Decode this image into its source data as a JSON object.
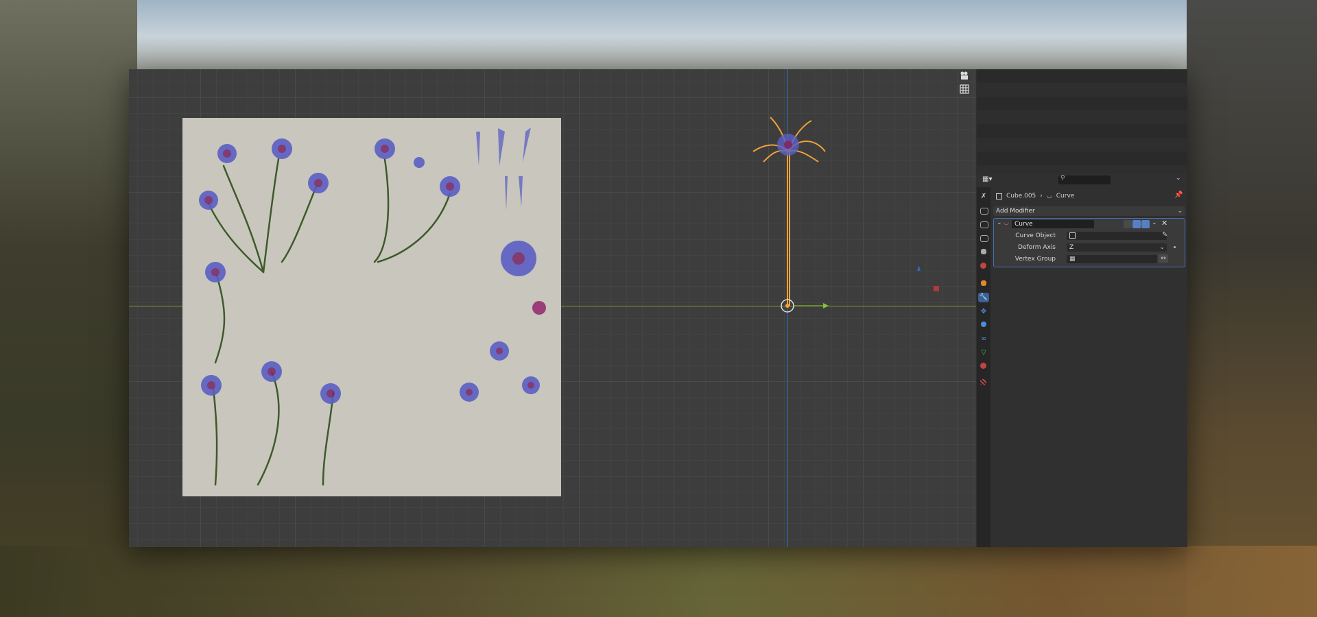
{
  "properties": {
    "breadcrumb": {
      "object": "Cube.005",
      "modifier": "Curve"
    },
    "add_modifier_label": "Add Modifier",
    "modifier": {
      "name": "Curve",
      "rows": {
        "curve_object_label": "Curve Object",
        "curve_object_value": "",
        "deform_axis_label": "Deform Axis",
        "deform_axis_value": "Z",
        "vertex_group_label": "Vertex Group",
        "vertex_group_value": ""
      }
    },
    "search_placeholder": ""
  },
  "colors": {
    "accent": "#4772b3",
    "x_axis": "#7aa12e",
    "z_axis": "#2f6bb8",
    "selection": "#f0a13a",
    "texture_bg": "#c8c6bd"
  },
  "icons": [
    "camera-icon",
    "grid-icon",
    "editor-type-icon",
    "search-icon",
    "tool-tab-icon",
    "render-tab-icon",
    "output-tab-icon",
    "view-layer-tab-icon",
    "scene-tab-icon",
    "world-tab-icon",
    "object-tab-icon",
    "modifier-tab-icon",
    "particles-tab-icon",
    "physics-tab-icon",
    "constraints-tab-icon",
    "data-tab-icon",
    "material-tab-icon",
    "texture-tab-icon",
    "pin-icon",
    "eyedropper-icon",
    "close-icon"
  ]
}
